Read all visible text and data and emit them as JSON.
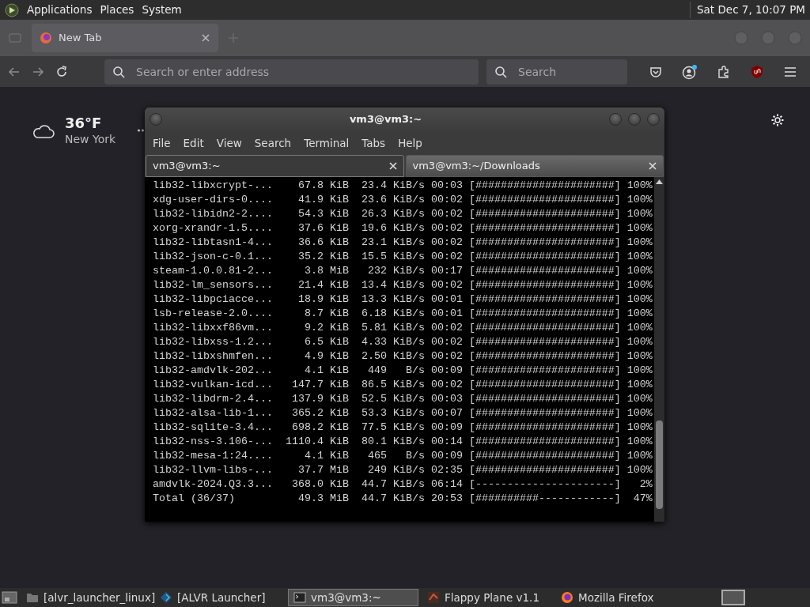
{
  "top_panel": {
    "menus": [
      "Applications",
      "Places",
      "System"
    ],
    "clock": "Sat Dec 7, 10:07 PM"
  },
  "browser": {
    "tabs": [
      {
        "label": "New Tab",
        "selected": true
      }
    ],
    "address_placeholder": "Search or enter address",
    "search_placeholder": "Search",
    "weather": {
      "temperature": "36°F",
      "location": "New York"
    }
  },
  "terminal": {
    "title": "vm3@vm3:~",
    "menus": [
      "File",
      "Edit",
      "View",
      "Search",
      "Terminal",
      "Tabs",
      "Help"
    ],
    "tabs": [
      {
        "label": "vm3@vm3:~",
        "selected": true
      },
      {
        "label": "vm3@vm3:~/Downloads",
        "selected": false
      }
    ],
    "lines": [
      "lib32-libxcrypt-...    67.8 KiB  23.4 KiB/s 00:03 [######################] 100%",
      "xdg-user-dirs-0....    41.9 KiB  23.6 KiB/s 00:02 [######################] 100%",
      "lib32-libidn2-2....    54.3 KiB  26.3 KiB/s 00:02 [######################] 100%",
      "xorg-xrandr-1.5....    37.6 KiB  19.6 KiB/s 00:02 [######################] 100%",
      "lib32-libtasn1-4...    36.6 KiB  23.1 KiB/s 00:02 [######################] 100%",
      "lib32-json-c-0.1...    35.2 KiB  15.5 KiB/s 00:02 [######################] 100%",
      "steam-1.0.0.81-2...     3.8 MiB   232 KiB/s 00:17 [######################] 100%",
      "lib32-lm_sensors...    21.4 KiB  13.4 KiB/s 00:02 [######################] 100%",
      "lib32-libpciacce...    18.9 KiB  13.3 KiB/s 00:01 [######################] 100%",
      "lsb-release-2.0....     8.7 KiB  6.18 KiB/s 00:01 [######################] 100%",
      "lib32-libxxf86vm...     9.2 KiB  5.81 KiB/s 00:02 [######################] 100%",
      "lib32-libxss-1.2...     6.5 KiB  4.33 KiB/s 00:02 [######################] 100%",
      "lib32-libxshmfen...     4.9 KiB  2.50 KiB/s 00:02 [######################] 100%",
      "lib32-amdvlk-202...     4.1 KiB   449   B/s 00:09 [######################] 100%",
      "lib32-vulkan-icd...   147.7 KiB  86.5 KiB/s 00:02 [######################] 100%",
      "lib32-libdrm-2.4...   137.9 KiB  52.5 KiB/s 00:03 [######################] 100%",
      "lib32-alsa-lib-1...   365.2 KiB  53.3 KiB/s 00:07 [######################] 100%",
      "lib32-sqlite-3.4...   698.2 KiB  77.5 KiB/s 00:09 [######################] 100%",
      "lib32-nss-3.106-...  1110.4 KiB  80.1 KiB/s 00:14 [######################] 100%",
      "lib32-mesa-1:24....     4.1 KiB   465   B/s 00:09 [######################] 100%",
      "lib32-llvm-libs-...    37.7 MiB   249 KiB/s 02:35 [######################] 100%",
      "amdvlk-2024.Q3.3...   368.0 KiB  44.7 KiB/s 06:14 [----------------------]   2%",
      "Total (36/37)          49.3 MiB  44.7 KiB/s 20:53 [##########------------]  47%"
    ]
  },
  "taskbar": {
    "items": [
      {
        "kind": "folder",
        "label": "[alvr_launcher_linux]",
        "selected": false
      },
      {
        "kind": "app",
        "label": "[ALVR Launcher]",
        "selected": false
      },
      {
        "kind": "terminal",
        "label": "vm3@vm3:~",
        "selected": true
      },
      {
        "kind": "game",
        "label": "Flappy Plane v1.1",
        "selected": false
      },
      {
        "kind": "browser",
        "label": "Mozilla Firefox",
        "selected": false
      }
    ]
  }
}
